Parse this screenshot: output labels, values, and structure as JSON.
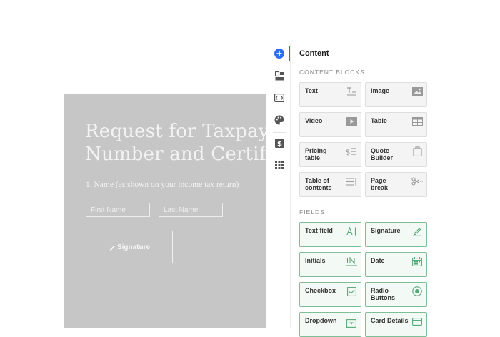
{
  "document": {
    "title_line1": "Request for Taxpayer Identification",
    "title_line2": "Number and Certification",
    "name_label": "1. Name (as shown on your income tax return)",
    "first_name_placeholder": "First Name",
    "last_name_placeholder": "Last Name",
    "signature_label": "Signature"
  },
  "rail": {
    "items": [
      "add-icon",
      "blocks-icon",
      "variables-icon",
      "palette-icon",
      "pricing-icon",
      "apps-icon"
    ],
    "active": "add-icon",
    "accent": "#2a6ef2"
  },
  "panel": {
    "title": "Content",
    "content_blocks_label": "CONTENT BLOCKS",
    "content_blocks": [
      {
        "label": "Text",
        "icon": "text-icon"
      },
      {
        "label": "Image",
        "icon": "image-icon"
      },
      {
        "label": "Video",
        "icon": "video-icon"
      },
      {
        "label": "Table",
        "icon": "table-icon"
      },
      {
        "label": "Pricing table",
        "icon": "pricing-table-icon"
      },
      {
        "label": "Quote Builder",
        "icon": "quote-builder-icon"
      },
      {
        "label": "Table of contents",
        "icon": "toc-icon"
      },
      {
        "label": "Page break",
        "icon": "scissors-icon"
      }
    ],
    "fields_label": "FIELDS",
    "fields": [
      {
        "label": "Text field",
        "icon": "text-field-icon"
      },
      {
        "label": "Signature",
        "icon": "signature-icon"
      },
      {
        "label": "Initials",
        "icon": "initials-icon"
      },
      {
        "label": "Date",
        "icon": "calendar-icon"
      },
      {
        "label": "Checkbox",
        "icon": "checkbox-icon"
      },
      {
        "label": "Radio Buttons",
        "icon": "radio-icon"
      },
      {
        "label": "Dropdown",
        "icon": "dropdown-icon"
      },
      {
        "label": "Card Details",
        "icon": "card-icon"
      }
    ],
    "field_accent": "#7fbf98"
  }
}
